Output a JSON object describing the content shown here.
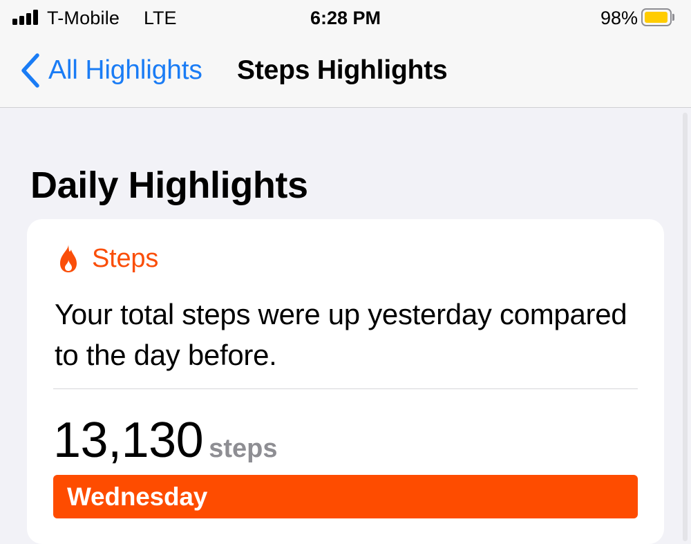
{
  "status_bar": {
    "carrier": "T-Mobile",
    "network": "LTE",
    "time": "6:28 PM",
    "battery_percent": "98%",
    "battery_level": 0.98,
    "battery_color": "#ffcc00"
  },
  "nav": {
    "back_label": "All Highlights",
    "title": "Steps Highlights"
  },
  "section": {
    "title": "Daily Highlights"
  },
  "card": {
    "icon": "flame-icon",
    "category": "Steps",
    "accent_color": "#fa4e09",
    "message": "Your total steps were up yesterday compared to the day before.",
    "value": "13,130",
    "unit": "steps",
    "bar_label": "Wednesday",
    "bar_color": "#fe4c00"
  }
}
